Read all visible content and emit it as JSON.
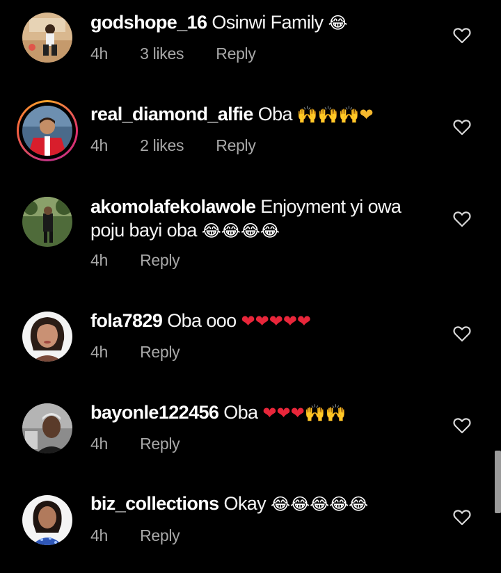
{
  "comments": [
    {
      "username": "godshope_16",
      "text": "Osinwi Family",
      "emoji": "😂",
      "time": "4h",
      "likes": "3 likes",
      "reply": "Reply"
    },
    {
      "username": "real_diamond_alfie",
      "text": "Oba",
      "emoji": "🙌🙌🙌❤",
      "time": "4h",
      "likes": "2 likes",
      "reply": "Reply"
    },
    {
      "username": "akomolafekolawole",
      "text": "Enjoyment yi owa poju bayi oba",
      "emoji": "😂😂😂😂",
      "time": "4h",
      "likes": "",
      "reply": "Reply"
    },
    {
      "username": "fola7829",
      "text": "Oba ooo",
      "emoji": "❤❤❤❤❤",
      "time": "4h",
      "likes": "",
      "reply": "Reply"
    },
    {
      "username": "bayonle122456",
      "text": "Oba",
      "emoji": "❤❤❤🙌🙌",
      "time": "4h",
      "likes": "",
      "reply": "Reply"
    },
    {
      "username": "biz_collections",
      "text": "Okay",
      "emoji": "😂😂😂😂😂",
      "time": "4h",
      "likes": "",
      "reply": "Reply"
    }
  ],
  "icons": {
    "like": "heart-outline-icon"
  },
  "colors": {
    "background": "#000000",
    "text": "#ffffff",
    "meta": "#a8a8a8",
    "heart_emoji": "#e8263a",
    "story_ring": "#e1306c"
  }
}
